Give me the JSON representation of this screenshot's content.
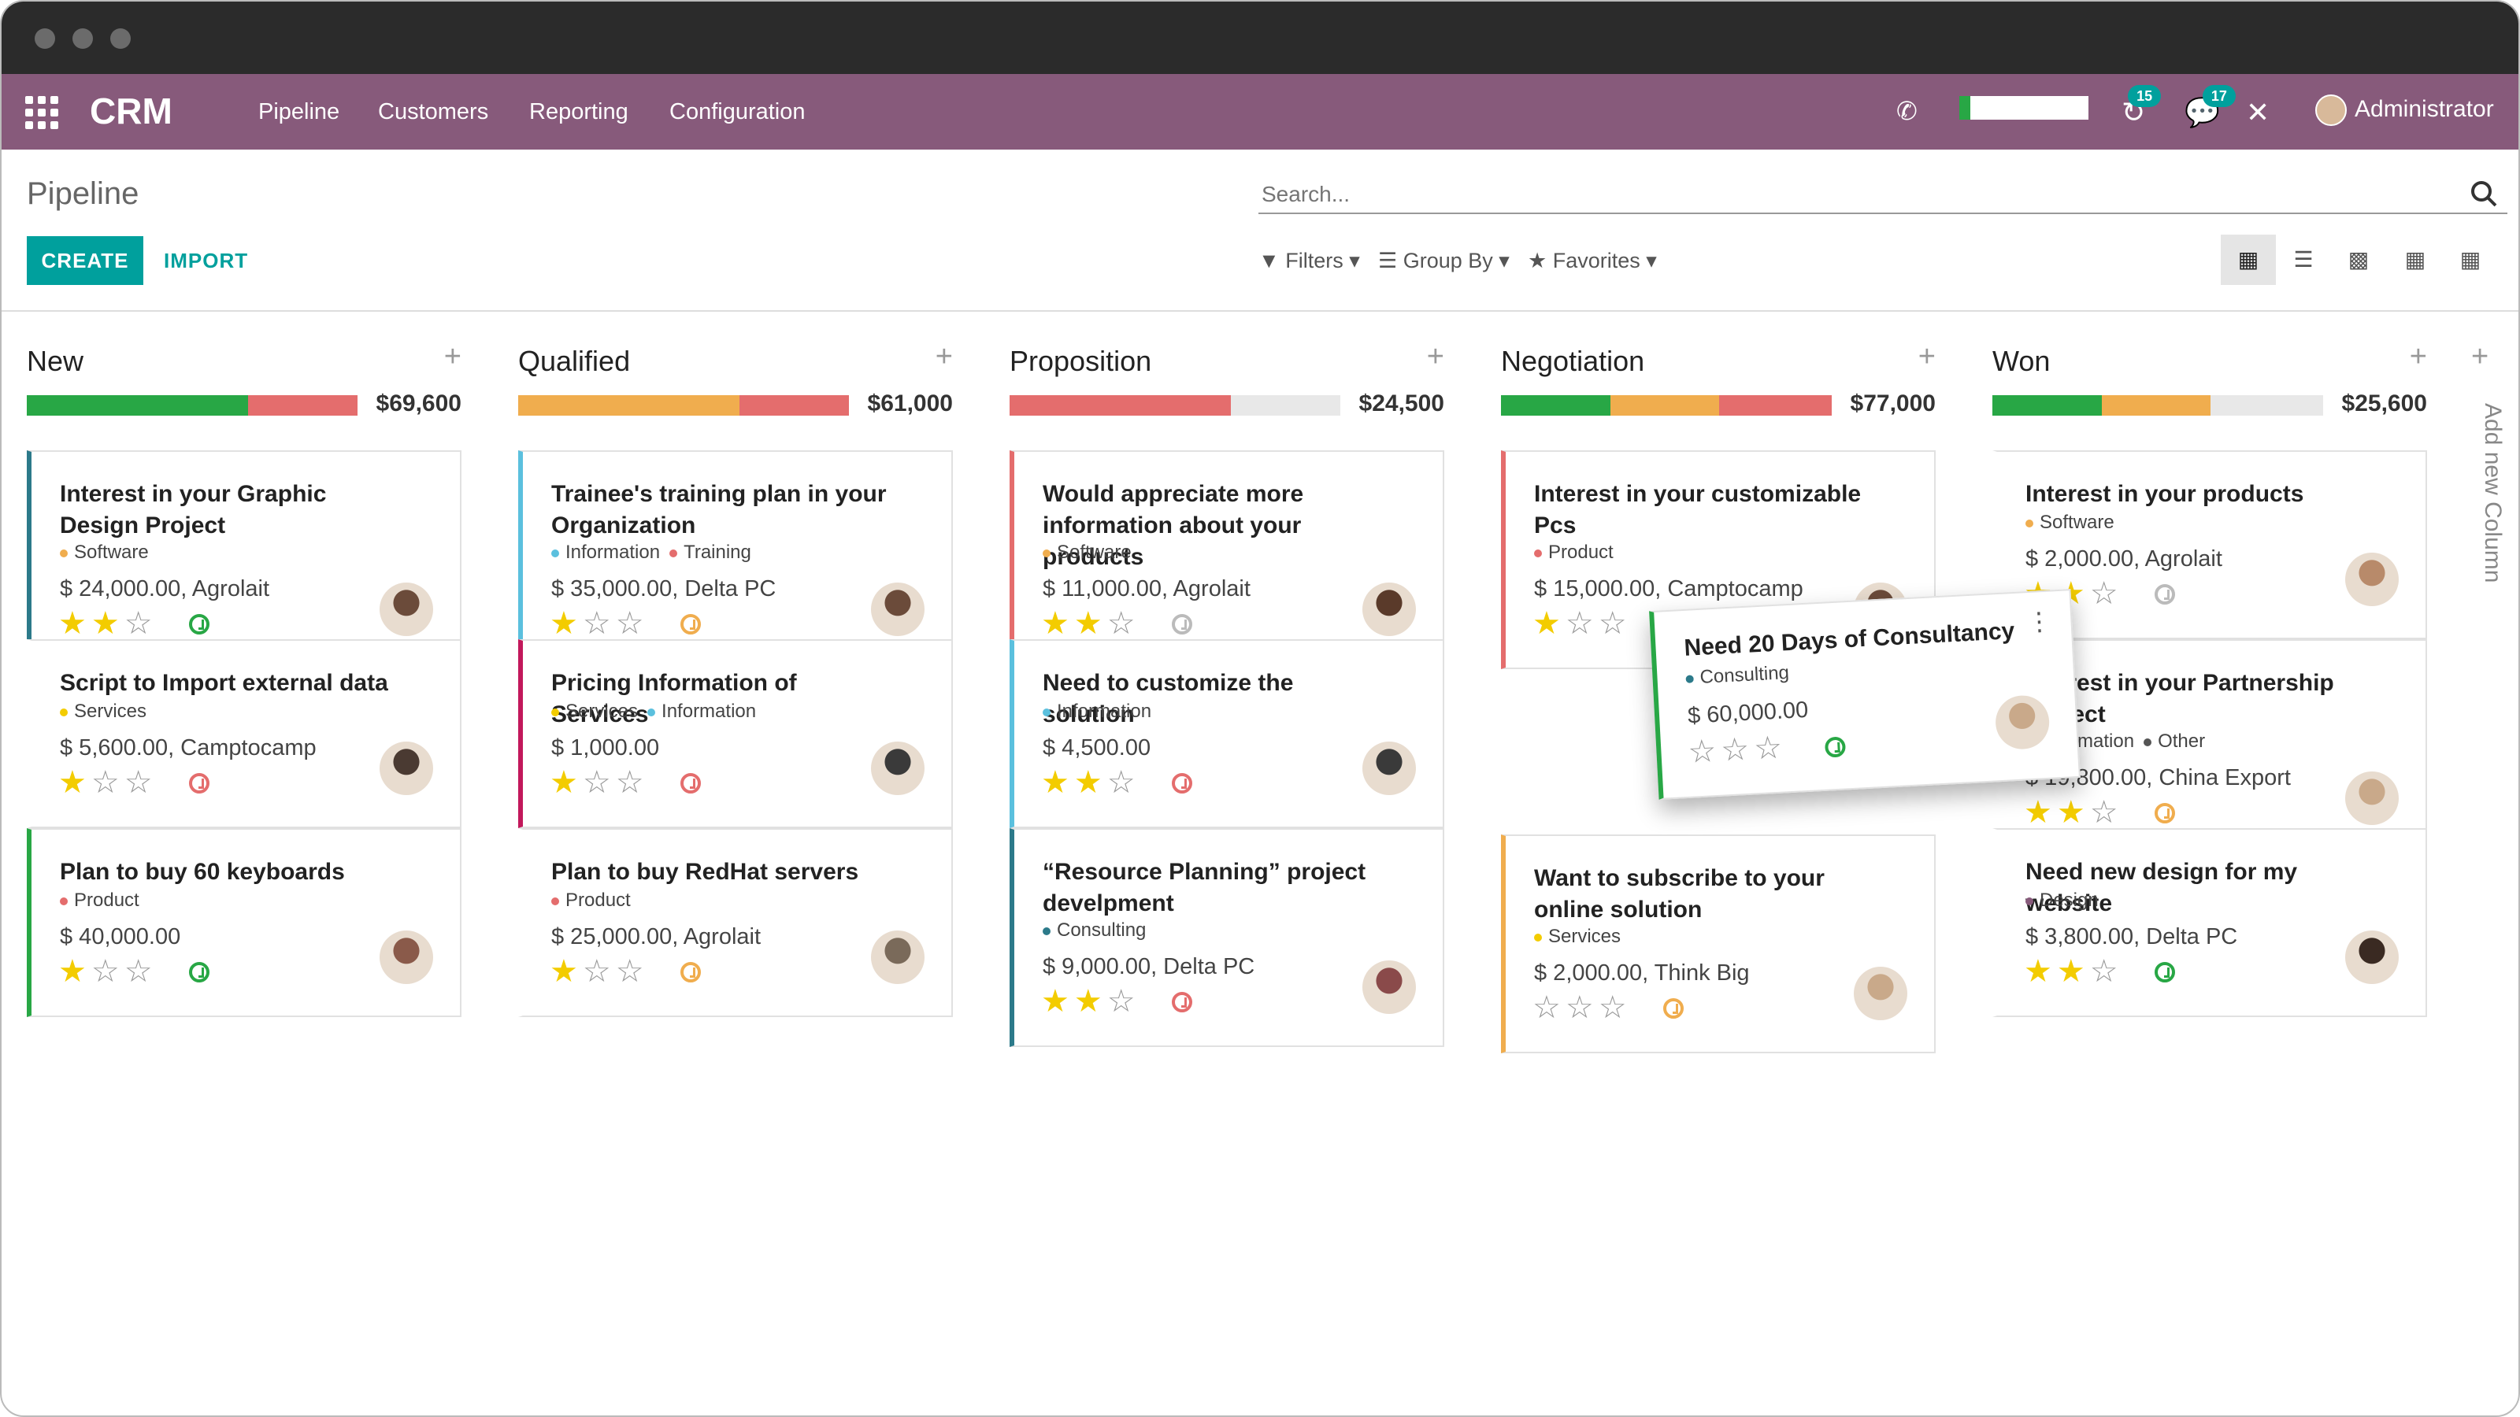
{
  "app": {
    "name": "CRM"
  },
  "nav": {
    "menu": [
      "Pipeline",
      "Customers",
      "Reporting",
      "Configuration"
    ],
    "activity_count": "15",
    "message_count": "17",
    "user": "Administrator"
  },
  "control": {
    "breadcrumb": "Pipeline",
    "create_label": "CREATE",
    "import_label": "IMPORT",
    "search_placeholder": "Search...",
    "filters_label": "Filters",
    "groupby_label": "Group By",
    "favorites_label": "Favorites",
    "views": [
      "kanban-icon",
      "list-icon",
      "graph-icon",
      "calendar-icon",
      "pivot-icon"
    ],
    "active_view": "kanban"
  },
  "colors": {
    "brand": "#875a7b",
    "accent": "#00a09d",
    "green": "#28a745",
    "orange": "#f0ad4e",
    "red": "#e46d6d",
    "star": "#f3cc00"
  },
  "columns": [
    {
      "title": "New",
      "total": "$69,600",
      "progress": [
        {
          "color": "green",
          "pct": 67
        },
        {
          "color": "red",
          "pct": 33
        }
      ],
      "cards": [
        {
          "title": "Interest in your Graphic Design Project",
          "tags": [
            {
              "name": "Software",
              "color": "#f0ad4e"
            }
          ],
          "amount": "$ 24,000.00, Agrolait",
          "stars": 2,
          "activity": "green",
          "border": "#2c7a8a",
          "avatar": "#6b4b3a"
        },
        {
          "title": "Script to Import external data",
          "tags": [
            {
              "name": "Services",
              "color": "#f3cc00"
            }
          ],
          "amount": "$ 5,600.00, Camptocamp",
          "stars": 1,
          "activity": "red",
          "border": "#ffffff",
          "avatar": "#4a3a32"
        },
        {
          "title": "Plan to buy 60 keyboards",
          "tags": [
            {
              "name": "Product",
              "color": "#e46d6d"
            }
          ],
          "amount": "$ 40,000.00",
          "stars": 1,
          "activity": "green",
          "border": "#28a745",
          "avatar": "#8a5a4a"
        }
      ]
    },
    {
      "title": "Qualified",
      "total": "$61,000",
      "progress": [
        {
          "color": "orange",
          "pct": 67
        },
        {
          "color": "red",
          "pct": 33
        }
      ],
      "cards": [
        {
          "title": "Trainee's training plan in your Organization",
          "tags": [
            {
              "name": "Information",
              "color": "#5bc0de"
            },
            {
              "name": "Training",
              "color": "#e46d6d"
            }
          ],
          "amount": "$ 35,000.00, Delta PC",
          "stars": 1,
          "activity": "orange",
          "border": "#5bc0de",
          "avatar": "#6b4b3a"
        },
        {
          "title": "Pricing Information of Services",
          "tags": [
            {
              "name": "Services",
              "color": "#f3cc00"
            },
            {
              "name": "Information",
              "color": "#5bc0de"
            }
          ],
          "amount": "$ 1,000.00",
          "stars": 1,
          "activity": "red",
          "border": "#c2185b",
          "avatar": "#3a3a3a"
        },
        {
          "title": "Plan to buy RedHat servers",
          "tags": [
            {
              "name": "Product",
              "color": "#e46d6d"
            }
          ],
          "amount": "$ 25,000.00, Agrolait",
          "stars": 1,
          "activity": "orange",
          "border": "#ffffff",
          "avatar": "#7a6a5a"
        }
      ]
    },
    {
      "title": "Proposition",
      "total": "$24,500",
      "progress": [
        {
          "color": "red",
          "pct": 67
        }
      ],
      "cards": [
        {
          "title": "Would appreciate more information about your products",
          "tags": [
            {
              "name": "Software",
              "color": "#f0ad4e"
            }
          ],
          "amount": "$ 11,000.00, Agrolait",
          "stars": 2,
          "activity": "gray",
          "border": "#e46d6d",
          "avatar": "#5a3a2a"
        },
        {
          "title": "Need to customize the solution",
          "tags": [
            {
              "name": "Information",
              "color": "#5bc0de"
            }
          ],
          "amount": "$ 4,500.00",
          "stars": 2,
          "activity": "red",
          "border": "#5bc0de",
          "avatar": "#3a3a3a"
        },
        {
          "title": "“Resource Planning” project develpment",
          "tags": [
            {
              "name": "Consulting",
              "color": "#2c7a8a"
            }
          ],
          "amount": "$ 9,000.00, Delta PC",
          "stars": 2,
          "activity": "red",
          "border": "#2c7a8a",
          "avatar": "#8a4a4a"
        }
      ]
    },
    {
      "title": "Negotiation",
      "total": "$77,000",
      "progress": [
        {
          "color": "green",
          "pct": 33
        },
        {
          "color": "orange",
          "pct": 33
        },
        {
          "color": "red",
          "pct": 34
        }
      ],
      "cards": [
        {
          "title": "Interest in your customizable Pcs",
          "tags": [
            {
              "name": "Product",
              "color": "#e46d6d"
            }
          ],
          "amount": "$ 15,000.00, Camptocamp",
          "stars": 1,
          "activity": "red",
          "border": "#e46d6d",
          "avatar": "#6b4b3a"
        },
        {
          "title": "Want to subscribe to your online solution",
          "tags": [
            {
              "name": "Services",
              "color": "#f3cc00"
            }
          ],
          "amount": "$ 2,000.00, Think Big",
          "stars": 0,
          "activity": "orange",
          "border": "#f0ad4e",
          "avatar": "#c9a98a"
        }
      ]
    },
    {
      "title": "Won",
      "total": "$25,600",
      "progress": [
        {
          "color": "green",
          "pct": 33
        },
        {
          "color": "orange",
          "pct": 33
        }
      ],
      "cards": [
        {
          "title": "Interest in your products",
          "tags": [
            {
              "name": "Software",
              "color": "#f0ad4e"
            }
          ],
          "amount": "$ 2,000.00, Agrolait",
          "stars": 2,
          "activity": "gray",
          "border": "#ffffff",
          "avatar": "#b88a6a"
        },
        {
          "title": "Interest in your Partnership Project",
          "tags": [
            {
              "name": "Information",
              "color": "#5bc0de"
            },
            {
              "name": "Other",
              "color": "#555555"
            }
          ],
          "amount": "$ 19,800.00, China Export",
          "stars": 2,
          "activity": "orange",
          "border": "#ffffff",
          "avatar": "#c9a98a"
        },
        {
          "title": "Need new design for my website",
          "tags": [
            {
              "name": "Design",
              "color": "#875a7b"
            }
          ],
          "amount": "$ 3,800.00, Delta PC",
          "stars": 2,
          "activity": "green",
          "border": "#ffffff",
          "avatar": "#3a2a22"
        }
      ]
    }
  ],
  "dragging_card": {
    "title": "Need 20 Days of Consultancy",
    "tags": [
      {
        "name": "Consulting",
        "color": "#2c7a8a"
      }
    ],
    "amount": "$ 60,000.00",
    "stars": 0,
    "activity": "green",
    "avatar": "#c9a98a"
  },
  "add_column_label": "Add new Column"
}
